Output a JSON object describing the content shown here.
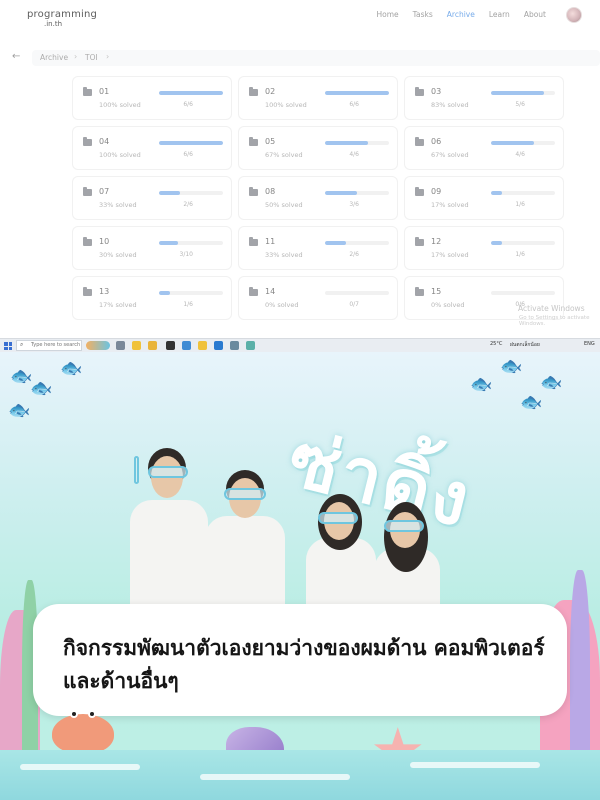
{
  "app": {
    "logo": {
      "line1": "programming",
      "line2": ".in.th"
    },
    "nav": [
      {
        "label": "Home",
        "active": false
      },
      {
        "label": "Tasks",
        "active": false
      },
      {
        "label": "Archive",
        "active": true
      },
      {
        "label": "Learn",
        "active": false
      },
      {
        "label": "About",
        "active": false
      }
    ],
    "breadcrumb": [
      "Archive",
      "TOI"
    ],
    "cards": [
      {
        "num": "01",
        "solved": "100% solved",
        "count": "6/6",
        "progress": 1.0
      },
      {
        "num": "02",
        "solved": "100% solved",
        "count": "6/6",
        "progress": 1.0
      },
      {
        "num": "03",
        "solved": "83% solved",
        "count": "5/6",
        "progress": 0.83
      },
      {
        "num": "04",
        "solved": "100% solved",
        "count": "6/6",
        "progress": 1.0
      },
      {
        "num": "05",
        "solved": "67% solved",
        "count": "4/6",
        "progress": 0.67
      },
      {
        "num": "06",
        "solved": "67% solved",
        "count": "4/6",
        "progress": 0.67
      },
      {
        "num": "07",
        "solved": "33% solved",
        "count": "2/6",
        "progress": 0.33
      },
      {
        "num": "08",
        "solved": "50% solved",
        "count": "3/6",
        "progress": 0.5
      },
      {
        "num": "09",
        "solved": "17% solved",
        "count": "1/6",
        "progress": 0.17
      },
      {
        "num": "10",
        "solved": "30% solved",
        "count": "3/10",
        "progress": 0.3
      },
      {
        "num": "11",
        "solved": "33% solved",
        "count": "2/6",
        "progress": 0.33
      },
      {
        "num": "12",
        "solved": "17% solved",
        "count": "1/6",
        "progress": 0.17
      },
      {
        "num": "13",
        "solved": "17% solved",
        "count": "1/6",
        "progress": 0.17
      },
      {
        "num": "14",
        "solved": "0% solved",
        "count": "0/7",
        "progress": 0.0
      },
      {
        "num": "15",
        "solved": "0% solved",
        "count": "0/6",
        "progress": 0.0
      }
    ],
    "watermark": {
      "title": "Activate Windows",
      "subtitle": "Go to Settings to activate Windows."
    },
    "colors": {
      "accent": "#5b9ae6",
      "progress_fill": "#8db8ec"
    }
  },
  "taskbar": {
    "search_placeholder": "Type here to search",
    "weather": "25°C",
    "weather_text": "ฝนตกเล็กน้อย",
    "language": "ENG"
  },
  "poster": {
    "title": "ซ่าดิ้ง",
    "caption": "กิจกรรมพัฒนาตัวเองยามว่างของผมด้าน คอมพิวเตอร์และด้านอื่นๆ"
  }
}
